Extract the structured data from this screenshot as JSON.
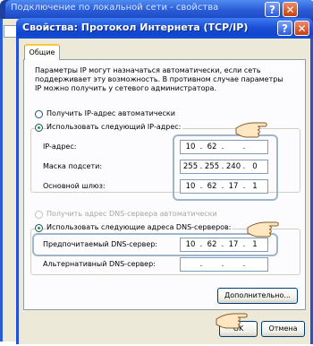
{
  "background_window": {
    "title": "Подключение по локальной сети - свойства",
    "help_label": "?",
    "close_label": "✕"
  },
  "dialog": {
    "title": "Свойства: Протокол Интернета (TCP/IP)",
    "help_label": "?",
    "close_label": "✕",
    "tab_label": "Общие",
    "description": "Параметры IP могут назначаться автоматически, если сеть\nподдерживает эту возможность. В противном случае параметры\nIP можно получить у сетевого администратора.",
    "ip_auto_label": "Получить IP-адрес автоматически",
    "ip_manual_label": "Использовать следующий IP-адрес:",
    "ip_address_label": "IP-адрес:",
    "ip_address": [
      "10",
      "62",
      "",
      ""
    ],
    "subnet_label": "Маска подсети:",
    "subnet_mask": [
      "255",
      "255",
      "240",
      "0"
    ],
    "gateway_label": "Основной шлюз:",
    "gateway": [
      "10",
      "62",
      "17",
      "1"
    ],
    "dns_auto_label": "Получить адрес DNS-сервера автоматически",
    "dns_manual_label": "Использовать следующие адреса DNS-серверов:",
    "preferred_dns_label": "Предпочитаемый DNS-сервер:",
    "preferred_dns": [
      "10",
      "62",
      "17",
      "1"
    ],
    "alternate_dns_label": "Альтернативный DNS-сервер:",
    "alternate_dns": [
      "",
      "",
      "",
      ""
    ],
    "advanced_button": "Дополнительно...",
    "ok_button": "OK",
    "cancel_button": "Отмена"
  },
  "colors": {
    "title_blue": "#0f45cf",
    "dialog_face": "#ece9d8",
    "highlight_border": "#9fb6c9"
  }
}
